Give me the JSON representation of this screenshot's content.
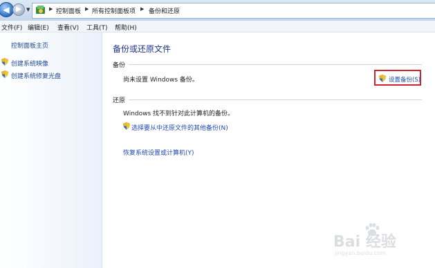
{
  "address_bar": {
    "breadcrumbs": [
      "控制面板",
      "所有控制面板项",
      "备份和还原"
    ]
  },
  "menu": {
    "items": [
      "文件(F)",
      "编辑(E)",
      "查看(V)",
      "工具(T)",
      "帮助(H)"
    ]
  },
  "left_pane": {
    "home": "控制面板主页",
    "links": [
      "创建系统映像",
      "创建系统修复光盘"
    ]
  },
  "main": {
    "title": "备份或还原文件",
    "backup": {
      "label": "备份",
      "status": "尚未设置 Windows 备份。",
      "setup_link": "设置备份(S)"
    },
    "restore": {
      "label": "还原",
      "status": "Windows 找不到针对此计算机的备份。",
      "other_backup_link": "选择要从中还原文件的其他备份(N)",
      "recover_link": "恢复系统设置或计算机(Y)"
    }
  },
  "watermark": {
    "text": "Bai 经验",
    "sub": "jingyan.baidu.com"
  },
  "colors": {
    "link": "#1e4bb0",
    "title": "#1e3287",
    "highlight_border": "#d2232a"
  }
}
